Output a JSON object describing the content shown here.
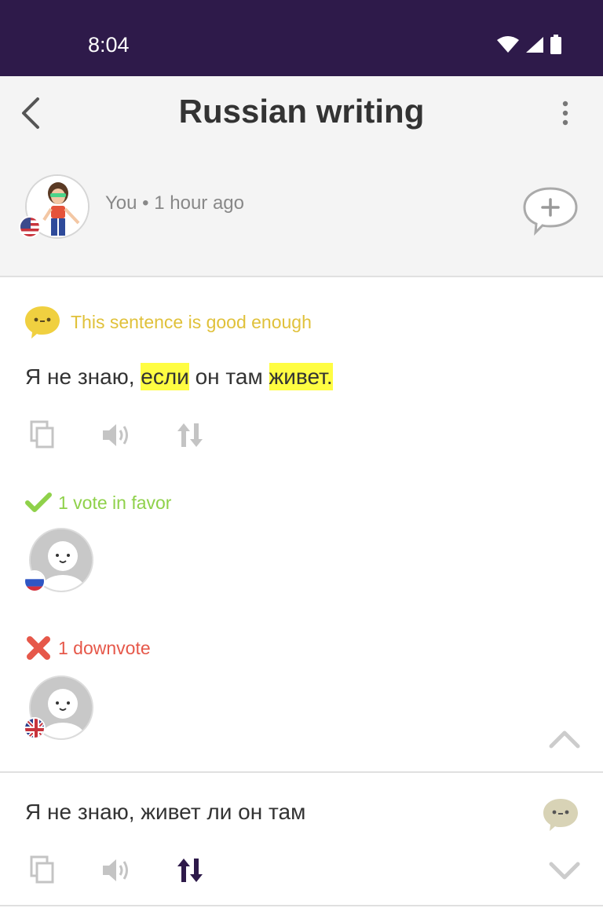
{
  "status_bar": {
    "time": "8:04"
  },
  "header": {
    "title": "Russian writing"
  },
  "author": {
    "meta": "You • 1 hour ago",
    "flag": "us-flag"
  },
  "correction": {
    "status_label": "This sentence is good enough",
    "sentence_parts": [
      {
        "text": "Я не знаю, ",
        "highlight": false
      },
      {
        "text": "если",
        "highlight": true
      },
      {
        "text": " он там ",
        "highlight": false
      },
      {
        "text": "живет.",
        "highlight": true
      }
    ],
    "actions": [
      "copy-icon",
      "speaker-icon",
      "sort-arrows-icon"
    ]
  },
  "votes": {
    "favor_label": "1 vote in favor",
    "favor_voter_flag": "ru-flag",
    "down_label": "1 downvote",
    "down_voter_flag": "uk-flag"
  },
  "second_correction": {
    "sentence": "Я не знаю, живет ли он там",
    "actions": [
      "copy-icon",
      "speaker-icon",
      "sort-arrows-icon"
    ]
  },
  "colors": {
    "status_bar": "#2e1a4a",
    "good_enough": "#e0c13a",
    "favor": "#8fd14a",
    "downvote": "#e6584a",
    "highlight": "#fffd42",
    "accent": "#2e1a4a"
  }
}
